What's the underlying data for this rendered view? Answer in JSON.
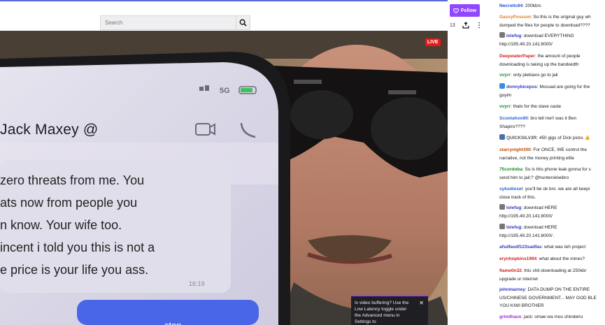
{
  "header": {
    "search_placeholder": "Search",
    "follow_label": "Follow",
    "viewer_count": "13"
  },
  "video": {
    "live_label": "LIVE",
    "tooltip": "Is video buffering? Use the Low Latency toggle under the Advanced menu in Settings to",
    "phone": {
      "status": "5G",
      "contact_name": "Jack Maxey @",
      "message_lines": [
        "zero threats from me. You",
        "ats now from people you",
        "n know.  Your wife too.",
        "incent i told you this is not a",
        "e price is your life you ass."
      ],
      "timestamp": "16:19",
      "bottom_text": "stop"
    }
  },
  "chat": {
    "messages": [
      {
        "user": "Necrotic64",
        "color": "#1e50d8",
        "badge": "",
        "text": ": 200kb/s",
        "cont": ""
      },
      {
        "user": "GassyPossum",
        "color": "#e0822a",
        "badge": "",
        "text": ": So this is the original guy wh",
        "cont": "dumped the files for people to download????"
      },
      {
        "user": "lolefug",
        "color": "#2e3bbd",
        "badge": "#777",
        "text": ": download EVERYTHING",
        "cont": "http://195.49.20.141:8000/"
      },
      {
        "user": "DeepwaterPaper",
        "color": "#d42121",
        "badge": "",
        "text": ": the amount of people",
        "cont": "downloading is taking up the bandwidth"
      },
      {
        "user": "vvyrr",
        "color": "#1a8a2a",
        "badge": "",
        "text": ": only plebians go to jail",
        "cont": ""
      },
      {
        "user": "donnybicepss",
        "color": "#2e3bbd",
        "badge": "#3b8de0",
        "text": ": Mossad are going for the",
        "cont": "goyim"
      },
      {
        "user": "vvyrr",
        "color": "#1a8a2a",
        "badge": "",
        "text": ": thats for the slave caste",
        "cont": ""
      },
      {
        "user": "Scootahoo90",
        "color": "#2f62d8",
        "badge": "",
        "text": ": bro tell me!! was it Ben",
        "cont": "Shapiro????"
      },
      {
        "user": "QUICKSILV3R",
        "color": "#555",
        "badge": "#4a6fa5",
        "text": ": 450 gigs of Dick picks 👍",
        "cont": ""
      },
      {
        "user": "starrynight300",
        "color": "#c24b00",
        "badge": "",
        "text": ": For ONCE, WE control the",
        "cont": "narrative, not the money printing elite"
      },
      {
        "user": "75cordoba",
        "color": "#1a8a2a",
        "badge": "",
        "text": ": So is this phone leak gonna for s",
        "cont": "send him to jail;? @hunterskiwibro"
      },
      {
        "user": "sykodiesel",
        "color": "#2f62d8",
        "badge": "",
        "text": ": you'll be ok bro. we are all keepi",
        "cont": "close track of this."
      },
      {
        "user": "lolefug",
        "color": "#2e3bbd",
        "badge": "#777",
        "text": ": download HERE",
        "cont": "http://195.49.20.141:8000/"
      },
      {
        "user": "lolefug",
        "color": "#2e3bbd",
        "badge": "#777",
        "text": ": download HERE",
        "cont": "http://195.49.20.141:8000/ ."
      },
      {
        "user": "afsdfasdf123sadfas",
        "color": "#2e3bbd",
        "badge": "",
        "text": ": what was teh project",
        "cont": ""
      },
      {
        "user": "erynhopkins1994",
        "color": "#d42121",
        "badge": "",
        "text": ": what about the mines?",
        "cont": ""
      },
      {
        "user": "flame0n32",
        "color": "#d42121",
        "badge": "",
        "text": ": this shit downloading at 250kb/",
        "cont": "upgrade ur internet"
      },
      {
        "user": "johnmarney",
        "color": "#2e3bbd",
        "badge": "",
        "text": ": DATA DUMP ON THE ENTIRE",
        "cont": "US/CHINESE GOVERNMENT... MAY GOD BLE"
      },
      {
        "user": "grindhaus",
        "color": "#9b2bd6",
        "badge": "",
        "text": ": jack: omae wa mou shindeiru",
        "cont": ""
      }
    ],
    "extra_line": "YOU KIWI BROTHER"
  }
}
